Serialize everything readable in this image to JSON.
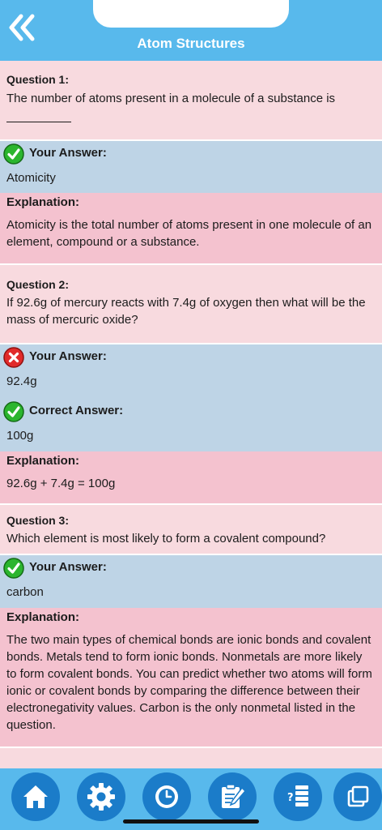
{
  "header": {
    "title": "Atom Structures"
  },
  "questions": [
    {
      "label": "Question 1:",
      "text": "The number of atoms present in a molecule of a substance is",
      "your_answer_label": "Your Answer:",
      "your_answer": "Atomicity",
      "explanation_label": "Explanation:",
      "explanation": "Atomicity is the total number of atoms present in one molecule of an element, compound or a substance."
    },
    {
      "label": "Question 2:",
      "text": "If 92.6g of mercury reacts with 7.4g of oxygen then what will be the mass of mercuric oxide?",
      "your_answer_label": "Your Answer:",
      "your_answer": "92.4g",
      "correct_answer_label": "Correct Answer:",
      "correct_answer": "100g",
      "explanation_label": "Explanation:",
      "explanation": "92.6g + 7.4g = 100g"
    },
    {
      "label": "Question 3:",
      "text": "Which element is most likely to form a covalent compound?",
      "your_answer_label": "Your Answer:",
      "your_answer": "carbon",
      "explanation_label": "Explanation:",
      "explanation": "The two main types of chemical bonds are ionic bonds and covalent bonds. Metals tend to form ionic bonds. Nonmetals are more likely to form covalent bonds. You can predict whether two atoms will form ionic or covalent bonds by comparing the difference between their electronegativity values. Carbon is the only nonmetal listed in the question."
    }
  ],
  "bottom_nav": [
    "home-icon",
    "gear-icon",
    "clock-icon",
    "edit-note-icon",
    "quiz-list-icon",
    "copy-icon"
  ],
  "colors": {
    "header": "#58b9ec",
    "nav_button": "#1b7cc9",
    "question_bg": "#f8dadf",
    "answer_bg": "#bed4e6",
    "explanation_bg": "#f4c2cf",
    "correct": "#2bb52e",
    "wrong": "#e12a2a"
  }
}
